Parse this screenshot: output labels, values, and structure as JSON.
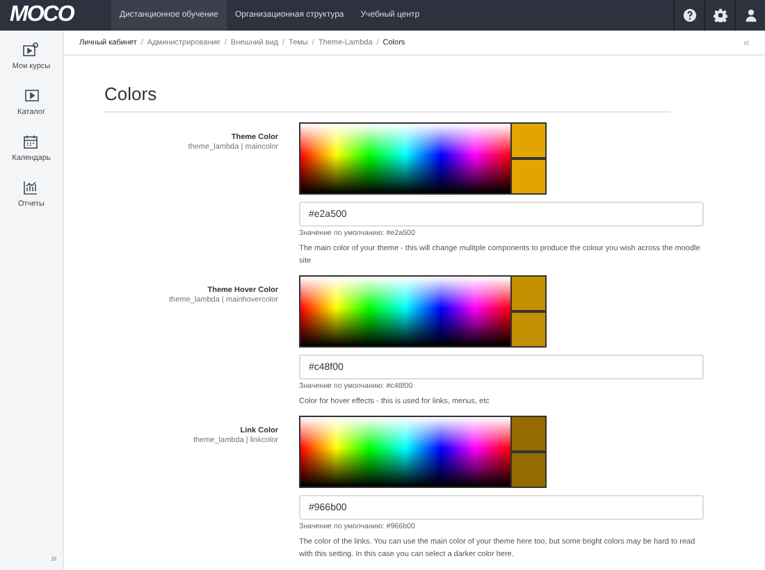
{
  "header": {
    "logo": "MOCO",
    "nav": [
      {
        "label": "Дистанционное обучение",
        "selected": true
      },
      {
        "label": "Организационная структура",
        "selected": false
      },
      {
        "label": "Учебный центр",
        "selected": false
      }
    ]
  },
  "sidebar": {
    "items": [
      {
        "label": "Мои курсы"
      },
      {
        "label": "Каталог"
      },
      {
        "label": "Календарь"
      },
      {
        "label": "Отчеты"
      }
    ],
    "expand": "»"
  },
  "breadcrumb": {
    "items": [
      "Личный кабинет",
      "Администрирование",
      "Внешний вид",
      "Темы",
      "Theme-Lambda",
      "Colors"
    ],
    "separator": "/",
    "collapse": "«"
  },
  "page_title": "Colors",
  "settings": [
    {
      "label": "Theme Color",
      "key": "theme_lambda | maincolor",
      "value": "#e2a500",
      "color": "#e2a500",
      "default": "Значение по умолчанию: #e2a500",
      "description": "The main color of your theme - this will change mulitple components to produce the colour you wish across the moodle site"
    },
    {
      "label": "Theme Hover Color",
      "key": "theme_lambda | mainhovercolor",
      "value": "#c48f00",
      "color": "#c48f00",
      "default": "Значение по умолчанию: #c48f00",
      "description": "Color for hover effects - this is used for links, menus, etc"
    },
    {
      "label": "Link Color",
      "key": "theme_lambda | linkcolor",
      "value": "#966b00",
      "color": "#966b00",
      "default": "Значение по умолчанию: #966b00",
      "description": "The color of the links. You can use the main color of your theme here too, but some bright colors may be hard to read with this setting. In this case you can select a darker color here."
    }
  ]
}
